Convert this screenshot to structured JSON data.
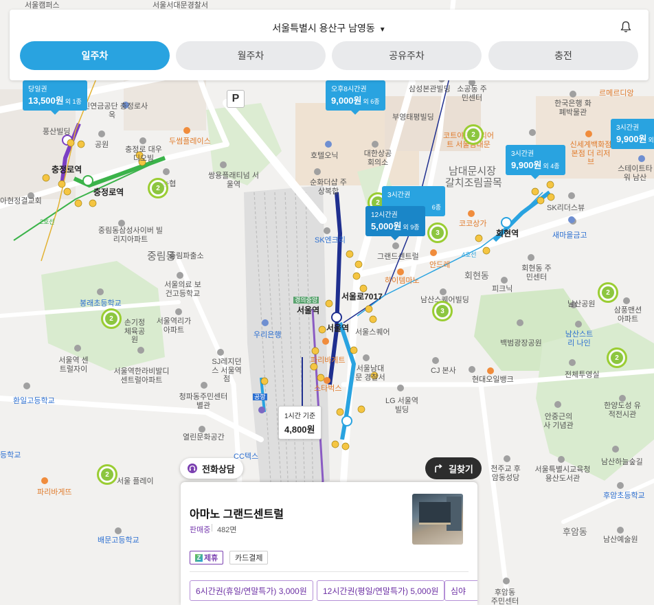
{
  "header": {
    "location": "서울특별시 용산구 남영동",
    "tabs": [
      {
        "label": "일주차",
        "active": true
      },
      {
        "label": "월주차",
        "active": false
      },
      {
        "label": "공유주차",
        "active": false
      },
      {
        "label": "충전",
        "active": false
      }
    ]
  },
  "map": {
    "price_tags": [
      {
        "title": "당일권",
        "price": "13,500원",
        "count": "외 1종"
      },
      {
        "title": "오후8시간권",
        "price": "9,000원",
        "count": "외 6종"
      },
      {
        "title": "3시간권",
        "price": "9,900원",
        "count": "외 4종"
      },
      {
        "title": "3시간권",
        "price": "9,900원",
        "count": "외"
      },
      {
        "title": "3시간권",
        "price": "",
        "count": "6종"
      },
      {
        "title": "12시간권",
        "price": "5,000원",
        "count": "외 9종"
      }
    ],
    "hourly_tag": {
      "title": "1시간 기준",
      "price": "4,800원"
    },
    "lot_markers": [
      "2",
      "2",
      "3",
      "2",
      "3",
      "2",
      "2",
      "2",
      "2"
    ],
    "labels": [
      "서울캠퍼스",
      "서울서대문경찰서",
      "국민연금공단 충정로사옥",
      "풍산빌딩",
      "공원",
      "충정로 대우디오빌",
      "두썸플레이스",
      "충정로역",
      "충정로역",
      "농협",
      "쌍용플래티넘 서울역",
      "순화더샵 주상복합",
      "호텔오닉",
      "대한상공 회의소",
      "삼성본관빌딩",
      "소공동 주민센터",
      "부영태평빌딩",
      "한국은행 화폐박물관",
      "르메르디앙",
      "남대문시장",
      "갈치조림골목",
      "코트야드 메리어트 서울남대문",
      "신세계백화점 본점 더 리저브",
      "스테이트타워 남산",
      "SK리더스뷰",
      "새마을금고",
      "회현역",
      "코코상가",
      "안드레",
      "SK엔크리",
      "그랜드센트럴",
      "하이템마노",
      "회현동",
      "회현동 주민센터",
      "피크닉",
      "남산스퀘어빌딩",
      "남산공원",
      "삼풍맨션 아파트",
      "남산스트리 나인",
      "백범광장공원",
      "서울역",
      "서울로7017",
      "서울역",
      "서울스퀘어",
      "우리은행",
      "중림동",
      "중림파출소",
      "중림동삼성사이버 빌리지아파트",
      "서울의료 보건고등학교",
      "봉래초등학교",
      "손기정 체육공원",
      "서울역리가 아파트",
      "서울역 센트럴자이",
      "서울역한라비발디 센트럴아파트",
      "SJ레지던스 서울역점",
      "서울남대문 경찰서",
      "CJ 본사",
      "현대오일뱅크",
      "전체투영실",
      "한양도성 유적전시관",
      "안중근의사 기념관",
      "LG 서울역빌딩",
      "파리바게트",
      "스타벅스",
      "청파동주민센터 별관",
      "열린문화공간",
      "환일고등학교",
      "서울 플레이",
      "배문고등학교",
      "파리바게뜨",
      "천주교 후암동성당",
      "서울특별시교육청 용산도서관",
      "남산하늘숲길",
      "후암초등학교",
      "후암동",
      "남산예술원",
      "후암동 주민센터",
      "아현정결교회",
      "2호선",
      "4호선",
      "경의중앙",
      "공항",
      "등학교",
      "CC텍스"
    ]
  },
  "buttons": {
    "phone": "전화상담",
    "route": "길찾기"
  },
  "parking": {
    "name": "아마노 그랜드센트럴",
    "status": "판매중",
    "spots": "482면",
    "badges": [
      "제휴",
      "카드결제"
    ],
    "tickets": [
      "6시간권(휴일/연말특가) 3,000원",
      "12시간권(평일/연말특가) 5,000원",
      "심야"
    ]
  },
  "colors": {
    "accent": "#29a3e0",
    "partner": "#7a3fb0",
    "lot_green": "#8cc63f",
    "line4": "#29a3e0",
    "line1": "#1f2f8f",
    "line2": "#3bb34a",
    "line5": "#7b3fc3"
  }
}
